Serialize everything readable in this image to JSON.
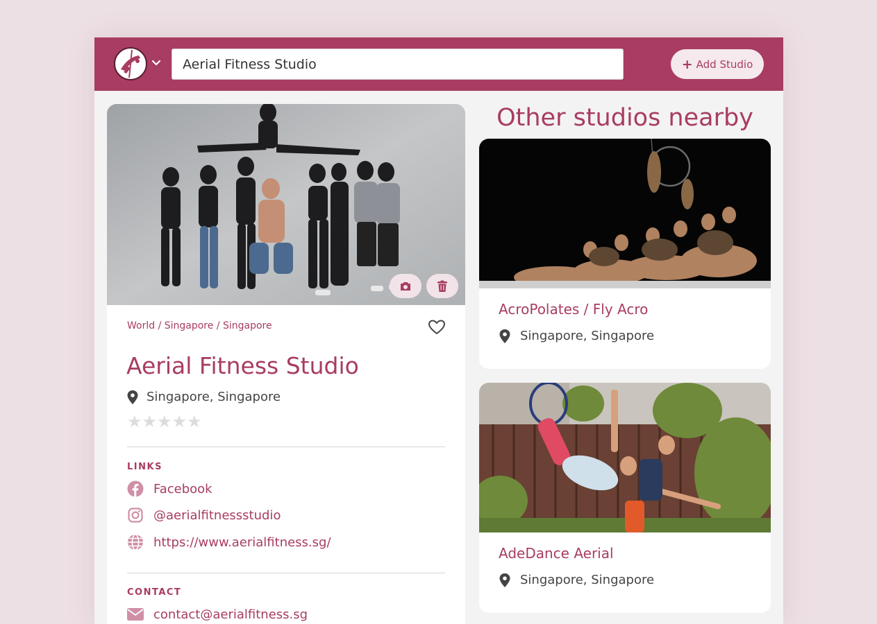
{
  "header": {
    "search_value": "Aerial Fitness Studio",
    "add_button_label": "Add Studio",
    "accent_color": "#a83c62"
  },
  "studio": {
    "breadcrumb": "World / Singapore / Singapore",
    "name": "Aerial Fitness Studio",
    "location": "Singapore, Singapore",
    "rating_stars": "★★★★★",
    "rating_value": 0,
    "links_label": "LINKS",
    "links": [
      {
        "icon": "facebook-icon",
        "text": "Facebook"
      },
      {
        "icon": "instagram-icon",
        "text": "@aerialfitnessstudio"
      },
      {
        "icon": "globe-icon",
        "text": "https://www.aerialfitness.sg/"
      }
    ],
    "contact_label": "CONTACT",
    "contact": [
      {
        "icon": "envelope-icon",
        "text": "contact@aerialfitness.sg"
      }
    ]
  },
  "nearby": {
    "title": "Other studios nearby",
    "studios": [
      {
        "name": "AcroPolates / Fly Acro",
        "location": "Singapore, Singapore"
      },
      {
        "name": "AdeDance Aerial",
        "location": "Singapore, Singapore"
      }
    ]
  }
}
